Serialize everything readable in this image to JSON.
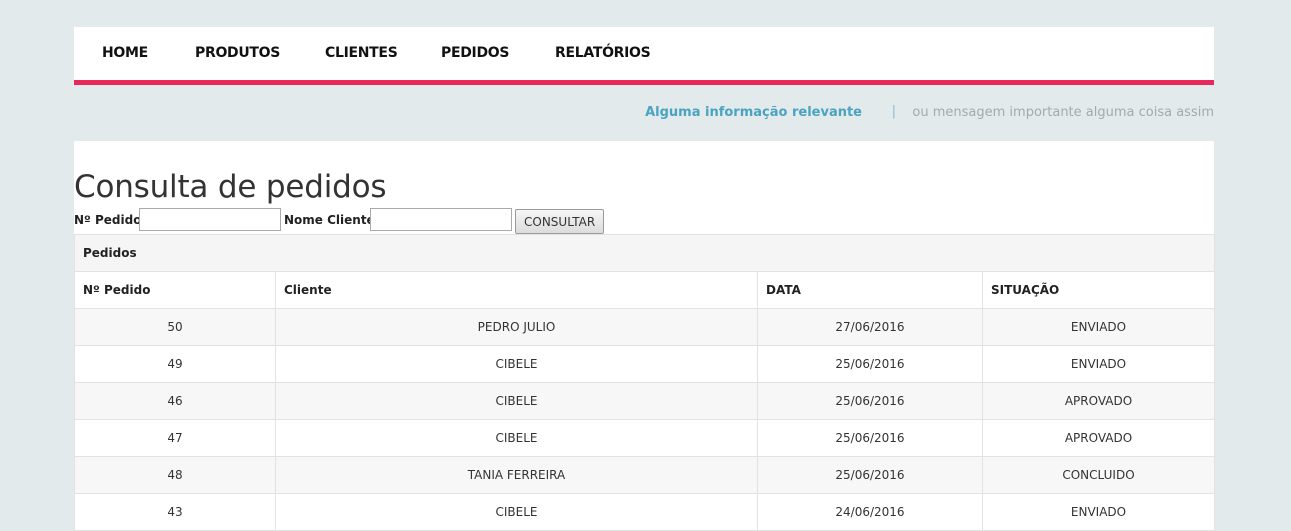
{
  "nav": {
    "items": [
      {
        "label": "HOME"
      },
      {
        "label": "PRODUTOS"
      },
      {
        "label": "CLIENTES"
      },
      {
        "label": "PEDIDOS"
      },
      {
        "label": "RELATÓRIOS"
      }
    ]
  },
  "info": {
    "relevant": "Alguma informação relevante",
    "separator": "|",
    "message": "ou mensagem importante alguma coisa assim"
  },
  "page": {
    "title": "Consulta de pedidos"
  },
  "search": {
    "order_label": "Nº Pedido:",
    "order_value": "",
    "client_label": "Nome Cliente:",
    "client_value": "",
    "button_label": "CONSULTAR"
  },
  "table": {
    "caption": "Pedidos",
    "columns": [
      "Nº Pedido",
      "Cliente",
      "DATA",
      "SITUAÇÃO"
    ],
    "rows": [
      [
        "50",
        "PEDRO JULIO",
        "27/06/2016",
        "ENVIADO"
      ],
      [
        "49",
        "CIBELE",
        "25/06/2016",
        "ENVIADO"
      ],
      [
        "46",
        "CIBELE",
        "25/06/2016",
        "APROVADO"
      ],
      [
        "47",
        "CIBELE",
        "25/06/2016",
        "APROVADO"
      ],
      [
        "48",
        "TANIA FERREIRA",
        "25/06/2016",
        "CONCLUIDO"
      ],
      [
        "43",
        "CIBELE",
        "24/06/2016",
        "ENVIADO"
      ]
    ]
  },
  "colors": {
    "accent": "#e8285a",
    "info_link": "#4aa3c0",
    "background": "#e3eaec"
  }
}
